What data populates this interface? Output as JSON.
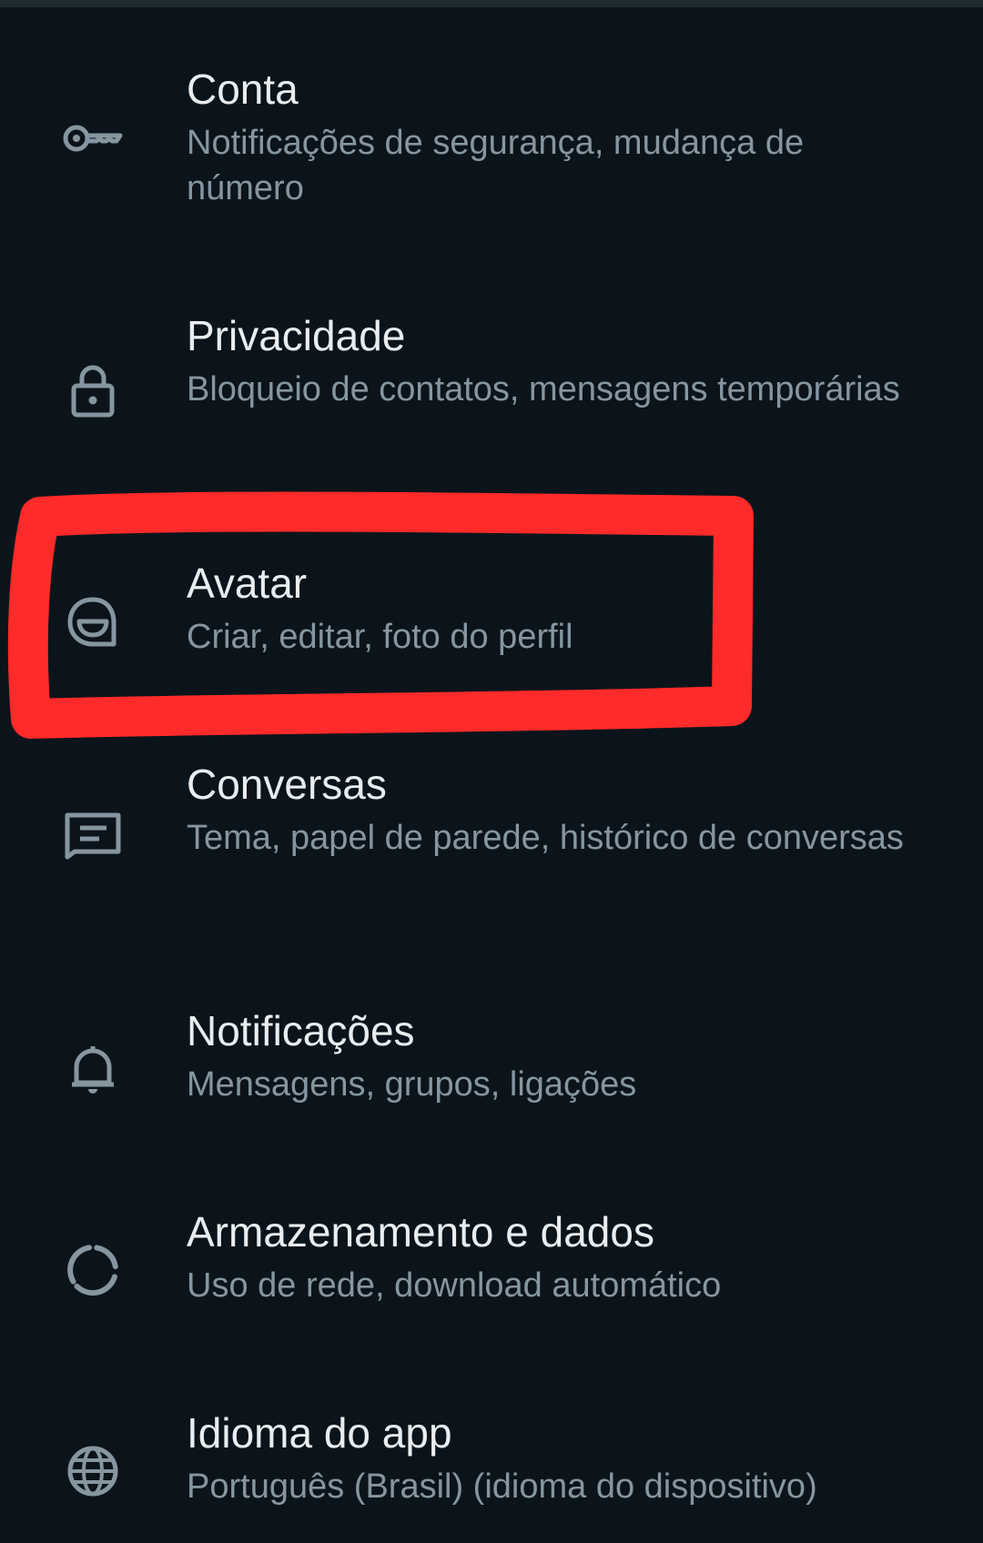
{
  "settings": {
    "items": [
      {
        "key": "conta",
        "icon": "key-icon",
        "title": "Conta",
        "subtitle": "Notificações de segurança, mudança de número"
      },
      {
        "key": "privacidade",
        "icon": "lock-icon",
        "title": "Privacidade",
        "subtitle": "Bloqueio de contatos, mensagens temporárias"
      },
      {
        "key": "avatar",
        "icon": "avatar-face-icon",
        "title": "Avatar",
        "subtitle": "Criar, editar, foto do perfil"
      },
      {
        "key": "conversas",
        "icon": "chat-icon",
        "title": "Conversas",
        "subtitle": "Tema, papel de parede, histórico de conversas"
      },
      {
        "key": "notificacoes",
        "icon": "bell-icon",
        "title": "Notificações",
        "subtitle": "Mensagens, grupos, ligações"
      },
      {
        "key": "armazenamento",
        "icon": "storage-circle-icon",
        "title": "Armazenamento e dados",
        "subtitle": "Uso de rede, download automático"
      },
      {
        "key": "idioma",
        "icon": "globe-icon",
        "title": "Idioma do app",
        "subtitle": "Português (Brasil) (idioma do dispositivo)"
      }
    ]
  },
  "colors": {
    "background": "#0b141a",
    "title": "#e9edef",
    "subtitle": "#8696a0",
    "icon": "#8696a0",
    "annotation": "#ff2a2a"
  }
}
